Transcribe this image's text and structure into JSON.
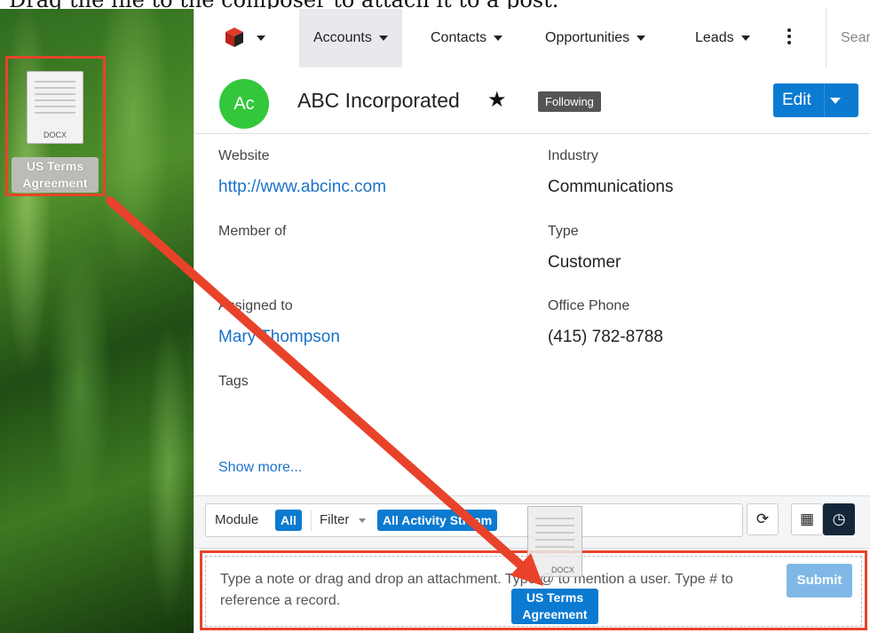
{
  "caption": "Drag the file to the composer to attach it to a post.",
  "colors": {
    "accent": "#0b7ad1",
    "avatar": "#33c73c",
    "highlight": "#e8432a",
    "link": "#1a72c9"
  },
  "desktop": {
    "file_icon": "docx-file-icon",
    "file_ext": "DOCX",
    "file_label": "US Terms Agreement"
  },
  "nav": {
    "logo_icon": "sugar-cube-icon",
    "items": [
      {
        "label": "Accounts",
        "active": true
      },
      {
        "label": "Contacts"
      },
      {
        "label": "Opportunities"
      },
      {
        "label": "Leads"
      }
    ],
    "more_icon": "kebab-icon",
    "search_placeholder": "Search"
  },
  "record": {
    "avatar": "Ac",
    "name": "ABC Incorporated",
    "favorite_icon": "star-icon",
    "following_badge": "Following",
    "edit_label": "Edit"
  },
  "fields": {
    "website": {
      "label": "Website",
      "value": "http://www.abcinc.com"
    },
    "industry": {
      "label": "Industry",
      "value": "Communications"
    },
    "member_of": {
      "label": "Member of",
      "value": ""
    },
    "type": {
      "label": "Type",
      "value": "Customer"
    },
    "assigned_to": {
      "label": "Assigned to",
      "value": "Mary Thompson"
    },
    "office_phone": {
      "label": "Office Phone",
      "value": "(415) 782-8788"
    },
    "tags": {
      "label": "Tags",
      "value": ""
    }
  },
  "show_more": "Show more...",
  "activity": {
    "module_label": "Module",
    "module_value": "All",
    "filter_label": "Filter",
    "filter_value": "All Activity Stream",
    "refresh_icon": "refresh-icon",
    "table_icon": "table-icon",
    "clock_icon": "clock-icon"
  },
  "composer": {
    "placeholder": "Type a note or drag and drop an attachment. Type @ to mention a user. Type # to reference a record.",
    "submit_label": "Submit",
    "drag_ext": "DOCX",
    "drag_label": "US Terms Agreement"
  }
}
